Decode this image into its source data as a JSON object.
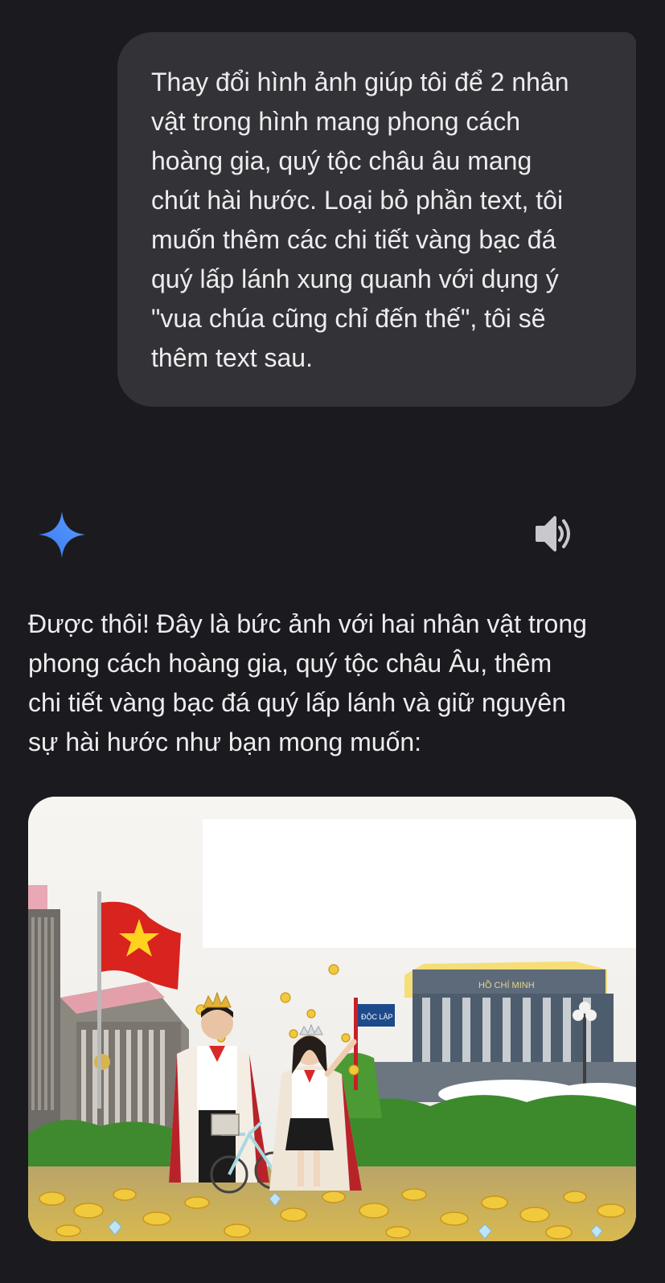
{
  "user_message": {
    "text": "Thay đổi hình ảnh giúp tôi để 2 nhân\nvật trong hình mang phong cách\nhoàng gia, quý tộc châu âu mang\nchút hài hước. Loại bỏ phần text, tôi\nmuốn thêm các chi tiết vàng bạc đá\nquý lấp lánh xung quanh với dụng ý\n\"vua chúa cũng chỉ đến thế\", tôi sẽ\nthêm text sau."
  },
  "assistant": {
    "icon": "gemini-sparkle-icon",
    "speaker_icon": "speaker-icon",
    "response_text": "Được thôi! Đây là bức ảnh với hai nhân vật trong\nphong cách hoàng gia, quý tộc châu Âu, thêm\nchi tiết vàng bạc đá quý lấp lánh và giữ nguyên\nsự hài hước như bạn mong muốn:"
  },
  "generated_image": {
    "sign_text": "ĐỘC LẬP",
    "mausoleum_text": "HỒ CHÍ MINH"
  },
  "colors": {
    "background": "#1b1b1f",
    "bubble": "#333337",
    "gemini_blue": "#4a8cf7"
  }
}
